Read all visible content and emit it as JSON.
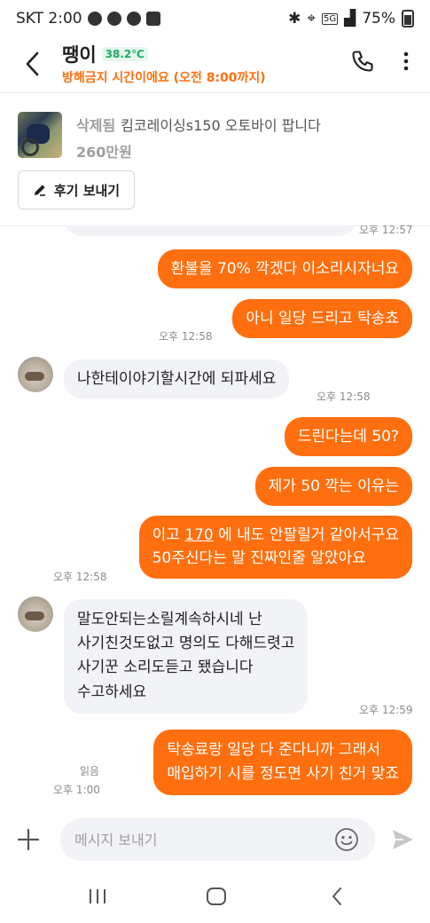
{
  "status_bar": {
    "carrier_time": "SKT 2:00",
    "network": "5G",
    "battery": "75%"
  },
  "header": {
    "title": "땡이",
    "temperature": "38.2℃",
    "subtitle": "방해금지 시간이에요 (오전 8:00까지)"
  },
  "product": {
    "status": "삭제됨",
    "name": "킴코레이싱s150 오토바이 팝니다",
    "price": "260만원",
    "review_button": "후기 보내기"
  },
  "messages": [
    {
      "id": "m0",
      "dir": "in",
      "text": "",
      "time": "오후 12:57"
    },
    {
      "id": "m1",
      "dir": "out",
      "text": "환불을 70% 깍겠다 이소리시자너요",
      "time": ""
    },
    {
      "id": "m2",
      "dir": "out",
      "text": "아니 일당 드리고 탁송쵸",
      "time": "오후 12:58"
    },
    {
      "id": "m3",
      "dir": "in",
      "text": "나한테이야기할시간에 되파세요",
      "time": "오후 12:58"
    },
    {
      "id": "m4",
      "dir": "out",
      "text": "드린다는데 50?",
      "time": ""
    },
    {
      "id": "m5",
      "dir": "out",
      "text": "제가 50 깍는 이유는",
      "time": ""
    },
    {
      "id": "m6",
      "dir": "out",
      "text_before": "이고 ",
      "text_link": "170",
      "text_after": " 에 내도 안팔릴거 같아서구요",
      "text_line2": "50주신다는 말 진짜인줄 알았아요",
      "time": "오후 12:58"
    },
    {
      "id": "m7",
      "dir": "in",
      "text": "말도안되는소릴계속하시네 난\n사기친것도없고 명의도 다해드렷고\n사기꾼 소리도듣고 됐습니다\n수고하세요",
      "time": "오후 12:59"
    },
    {
      "id": "m8",
      "dir": "out",
      "text": "탁송료랑 일당 다 준다니까 그래서\n매입하기 시를 정도면 사기 친거 맞죠",
      "read": "읽음",
      "time": "오후 1:00"
    }
  ],
  "input": {
    "placeholder": "메시지 보내기"
  },
  "icons": {
    "back": "chevron-left-icon",
    "call": "phone-icon",
    "more": "more-vertical-icon",
    "review": "pencil-icon",
    "plus": "plus-icon",
    "emoji": "smile-icon",
    "send": "send-icon"
  },
  "colors": {
    "accent": "#ff6f0f",
    "temperature": "#1aab5f",
    "incoming_bubble": "#f2f3f6"
  }
}
